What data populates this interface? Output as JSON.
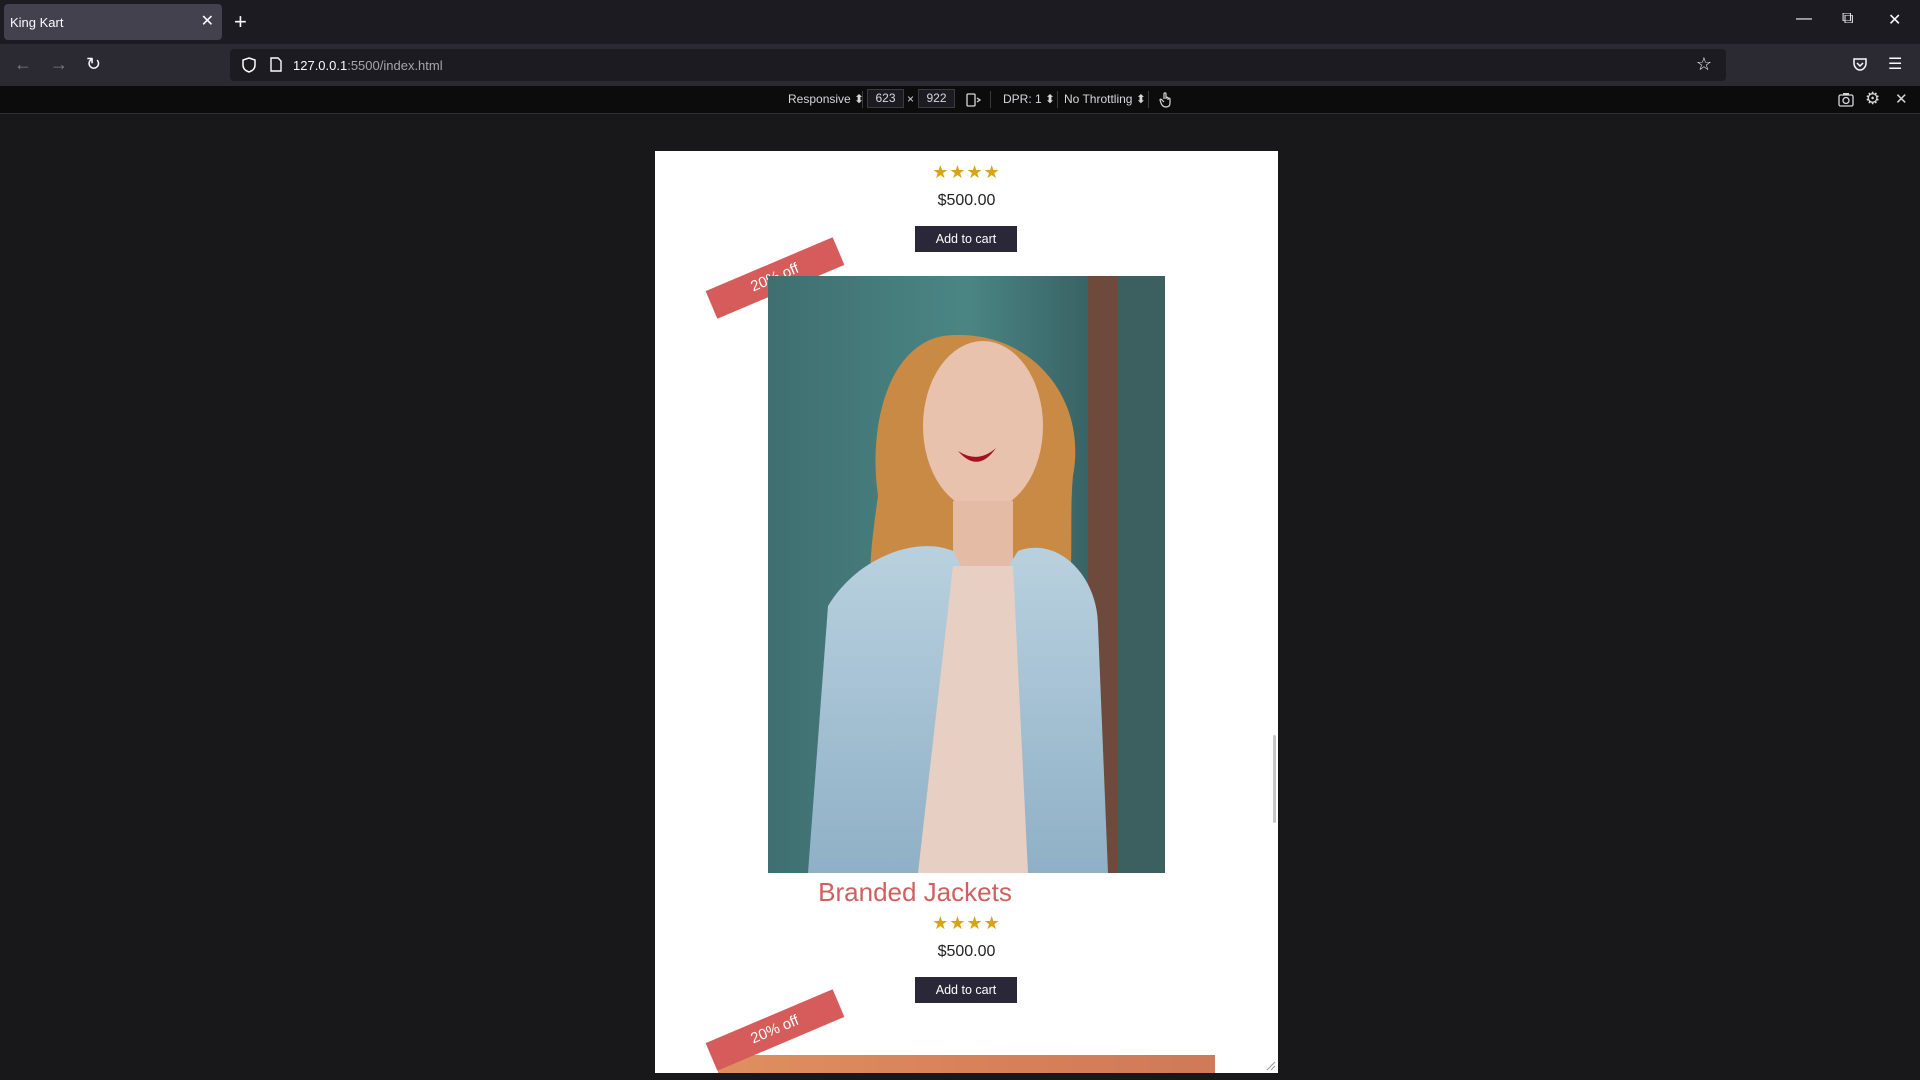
{
  "browser": {
    "tab_title": "King Kart",
    "tab_close": "✕",
    "new_tab": "+",
    "url_host": "127.0.0.1",
    "url_rest": ":5500/index.html"
  },
  "rdm": {
    "device": "Responsive ⬍",
    "width": "623",
    "times": "×",
    "height": "922",
    "dpr": "DPR: 1 ⬍",
    "throttling": "No Throttling ⬍"
  },
  "page": {
    "product_top": {
      "stars": "★★★★",
      "price": "$500.00",
      "button": "Add to cart"
    },
    "product_2": {
      "badge": "20% off",
      "name": "Branded Jackets",
      "stars": "★★★★",
      "price": "$500.00",
      "button": "Add to cart"
    },
    "product_3": {
      "badge": "20% off"
    }
  },
  "colors": {
    "badge": "#d65c5c",
    "star": "#d9a21b",
    "button": "#2a2838",
    "product_name": "#d06060"
  }
}
